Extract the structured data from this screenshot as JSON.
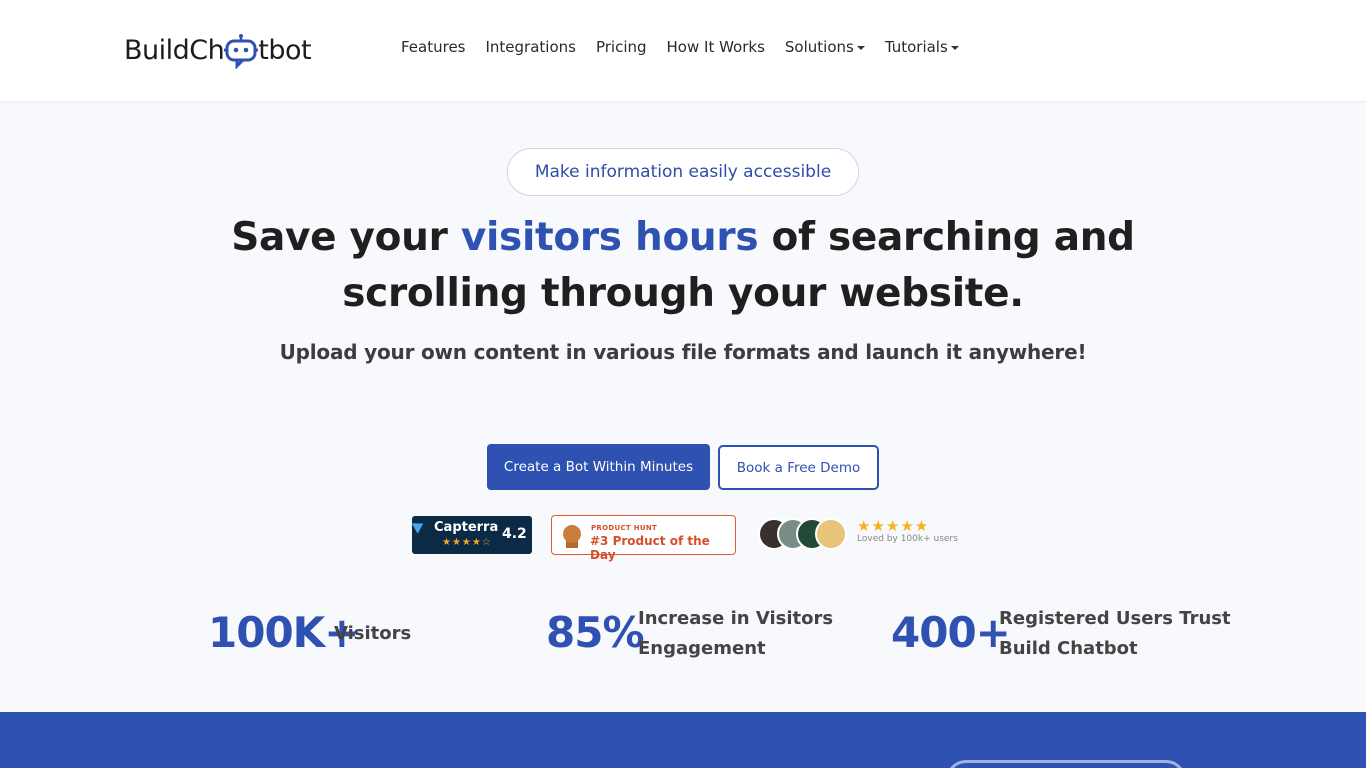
{
  "nav": {
    "logo_text_left": "BuildCh",
    "logo_text_right": "tbot",
    "links": [
      {
        "label": "Features",
        "dropdown": false
      },
      {
        "label": "Integrations",
        "dropdown": false
      },
      {
        "label": "Pricing",
        "dropdown": false
      },
      {
        "label": "How It Works",
        "dropdown": false
      },
      {
        "label": "Solutions",
        "dropdown": true
      },
      {
        "label": "Tutorials",
        "dropdown": true
      }
    ]
  },
  "hero": {
    "pill": "Make information easily accessible",
    "headline_pre": "Save your ",
    "headline_highlight": "visitors hours",
    "headline_post": " of searching and scrolling through your website.",
    "subtitle": "Upload your own content in various file formats and launch it anywhere!",
    "primary_button": "Create a Bot Within Minutes",
    "secondary_button": "Book a Free Demo"
  },
  "badges": {
    "capterra": {
      "name": "Capterra",
      "score": "4.2",
      "stars": "★★★★☆"
    },
    "product_hunt": {
      "caption": "PRODUCT HUNT",
      "title": "#3 Product of the Day"
    },
    "users": {
      "stars": "★★★★★",
      "text": "Loved by 100k+ users"
    }
  },
  "stats": [
    {
      "value": "100K+",
      "label": "Visitors"
    },
    {
      "value": "85%",
      "label_line1": "Increase in Visitors",
      "label_line2": "Engagement"
    },
    {
      "value": "400+",
      "label_line1": "Registered Users Trust",
      "label_line2": "Build Chatbot"
    }
  ],
  "colors": {
    "brand": "#2f52b2",
    "text": "#1f1f1f",
    "product_hunt": "#d4502a",
    "capterra_bg": "#0b2a45"
  }
}
